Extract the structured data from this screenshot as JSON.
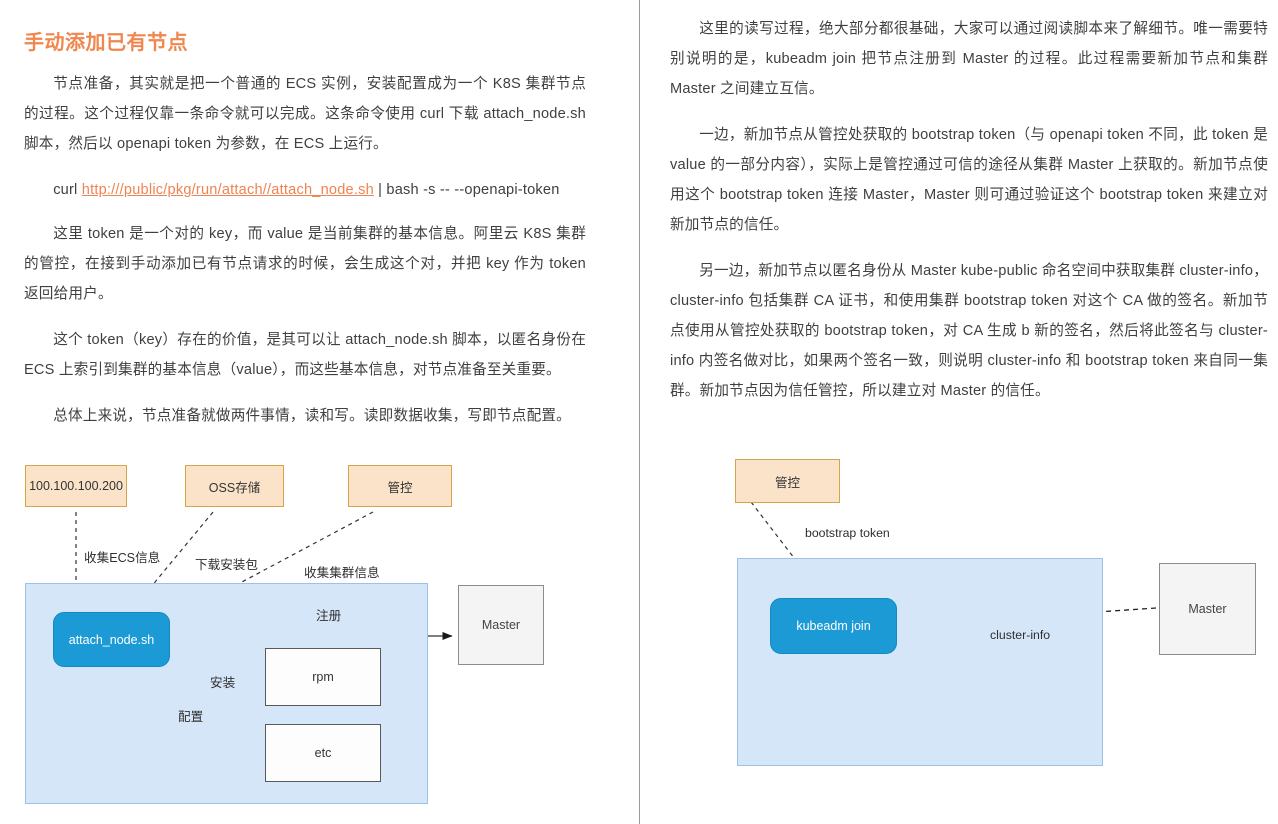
{
  "document": {
    "left_column": {
      "heading": "手动添加已有节点",
      "paragraphs": [
        "节点准备，其实就是把一个普通的 ECS 实例，安装配置成为一个 K8S 集群节点的过程。这个过程仅靠一条命令就可以完成。这条命令使用 curl 下载 attach_node.sh 脚本，然后以 openapi token 为参数，在 ECS 上运行。"
      ],
      "code": {
        "prefix": "curl ",
        "link": "http:///public/pkg/run/attach//attach_node.sh",
        "suffix": " | bash -s -- --openapi-token"
      },
      "paragraphs_after_code": [
        "这里 token 是一个对的 key，而 value 是当前集群的基本信息。阿里云 K8S 集群的管控，在接到手动添加已有节点请求的时候，会生成这个对，并把 key 作为 token 返回给用户。",
        "这个 token（key）存在的价值，是其可以让 attach_node.sh 脚本，以匿名身份在 ECS 上索引到集群的基本信息（value），而这些基本信息，对节点准备至关重要。",
        "总体上来说，节点准备就做两件事情，读和写。读即数据收集，写即节点配置。"
      ]
    },
    "right_column": {
      "paragraphs": [
        "这里的读写过程，绝大部分都很基础，大家可以通过阅读脚本来了解细节。唯一需要特别说明的是，kubeadm join 把节点注册到 Master 的过程。此过程需要新加节点和集群 Master 之间建立互信。",
        "一边，新加节点从管控处获取的 bootstrap token（与 openapi token 不同，此 token 是 value 的一部分内容），实际上是管控通过可信的途径从集群 Master 上获取的。新加节点使用这个 bootstrap token 连接 Master，Master 则可通过验证这个 bootstrap token 来建立对新加节点的信任。",
        "另一边，新加节点以匿名身份从 Master kube-public 命名空间中获取集群 cluster-info，cluster-info 包括集群 CA 证书，和使用集群 bootstrap token 对这个 CA 做的签名。新加节点使用从管控处获取的 bootstrap token，对 CA 生成 b 新的签名，然后将此签名与 cluster-info 内签名做对比，如果两个签名一致，则说明 cluster-info 和 bootstrap token 来自同一集群。新加节点因为信任管控，所以建立对 Master 的信任。"
      ]
    }
  },
  "diagram_left": {
    "name": "node-preparation-diagram",
    "nodes": {
      "metadata_service": "100.100.100.200",
      "oss_storage": "OSS存储",
      "control_plane": "管控",
      "script": "attach_node.sh",
      "rpm": "rpm",
      "etc": "etc",
      "master": "Master"
    },
    "edge_labels": {
      "collect_ecs": "收集ECS信息",
      "download_pkg": "下载安装包",
      "collect_cluster": "收集集群信息",
      "register": "注册",
      "install": "安装",
      "configure": "配置"
    },
    "colors": {
      "orange_fill": "#fbe3c9",
      "orange_border": "#d5a54b",
      "blue_node": "#1c9ad6",
      "zone_fill": "#d6e6f9",
      "zone_border": "#9cc2ea",
      "gray_fill": "#f4f4f4"
    }
  },
  "diagram_right": {
    "name": "kubeadm-join-trust-diagram",
    "nodes": {
      "control_plane": "管控",
      "kubeadm_join": "kubeadm join",
      "master": "Master"
    },
    "edge_labels": {
      "bootstrap_token": "bootstrap token",
      "cluster_info": "cluster-info"
    },
    "colors": {
      "orange_fill": "#fbe3c9",
      "orange_border": "#d5a54b",
      "blue_node": "#1c9ad6",
      "zone_fill": "#d6e6f9",
      "zone_border": "#9cc2ea",
      "gray_fill": "#f4f4f4",
      "accent_arrow": "#3d8fd6"
    }
  }
}
